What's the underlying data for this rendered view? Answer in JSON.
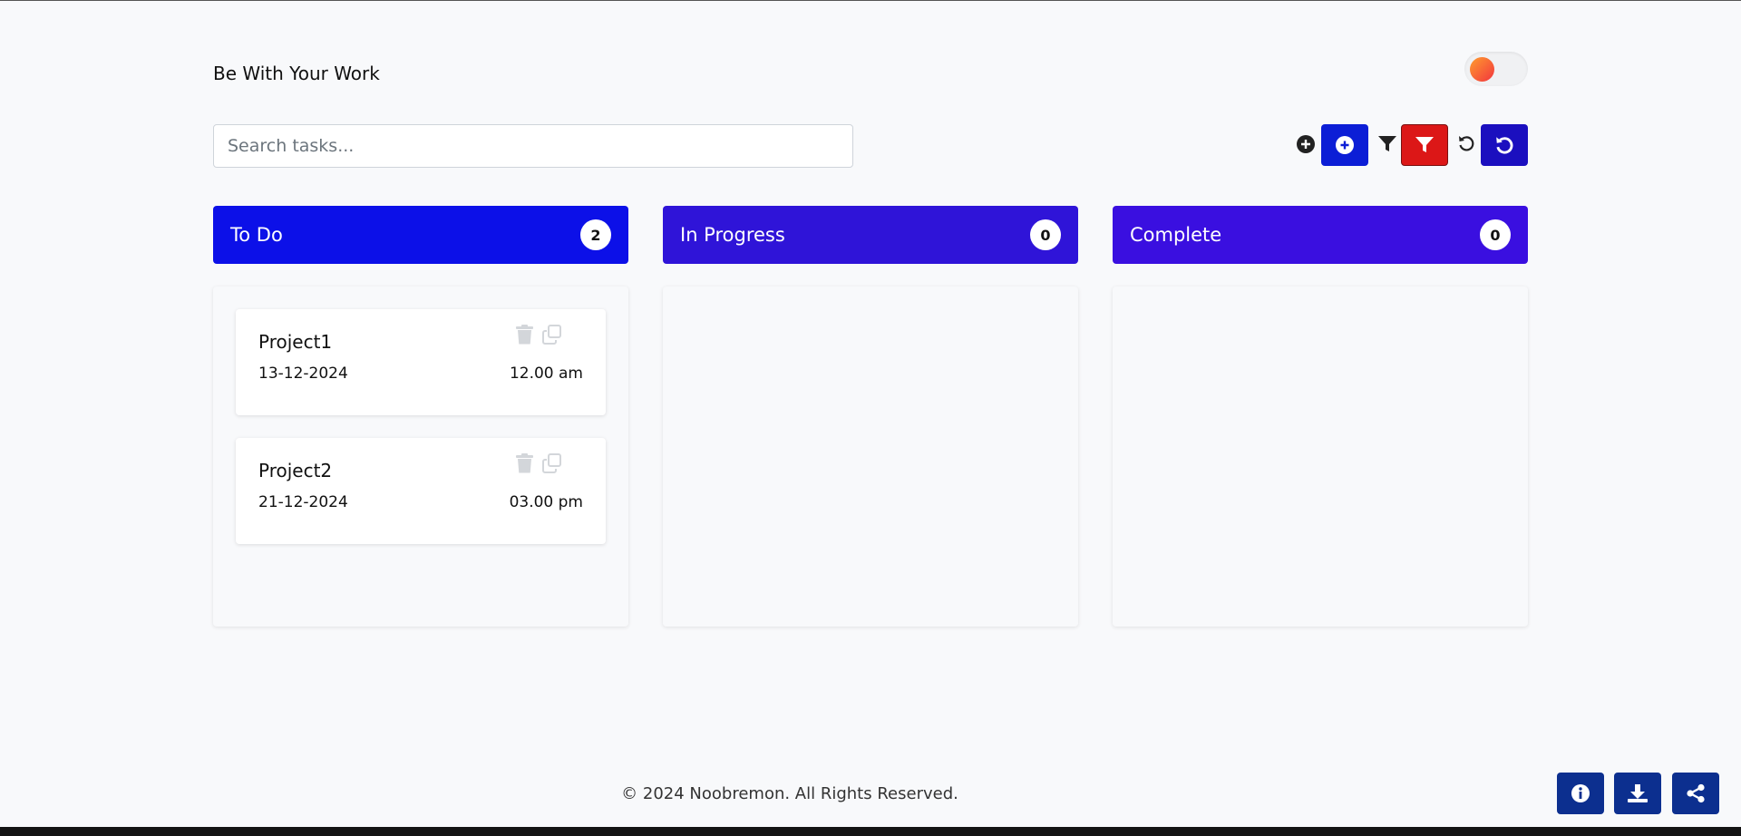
{
  "header": {
    "title": "Be With Your Work"
  },
  "theme_toggle": {
    "state": "light"
  },
  "search": {
    "placeholder": "Search tasks...",
    "value": ""
  },
  "toolbar": {
    "icons": [
      "plus-circle-icon",
      "filter-icon",
      "reset-icon"
    ],
    "buttons": [
      "add-task-button",
      "filter-button",
      "reset-button"
    ],
    "colors": {
      "add": "#0c1ed6",
      "filter": "#dc1717",
      "reset": "#1b0fbf"
    }
  },
  "columns": [
    {
      "label": "To Do",
      "count": "2",
      "color": "#0c10e8",
      "cards": [
        {
          "name": "Project1",
          "date": "13-12-2024",
          "time": "12.00 am"
        },
        {
          "name": "Project2",
          "date": "21-12-2024",
          "time": "03.00 pm"
        }
      ]
    },
    {
      "label": "In Progress",
      "count": "0",
      "color": "#2f14d8",
      "cards": []
    },
    {
      "label": "Complete",
      "count": "0",
      "color": "#3a0fe0",
      "cards": []
    }
  ],
  "footer": {
    "copyright": "© 2024 Noobremon. All Rights Reserved.",
    "fab_icons": [
      "info-icon",
      "download-icon",
      "share-icon"
    ]
  }
}
